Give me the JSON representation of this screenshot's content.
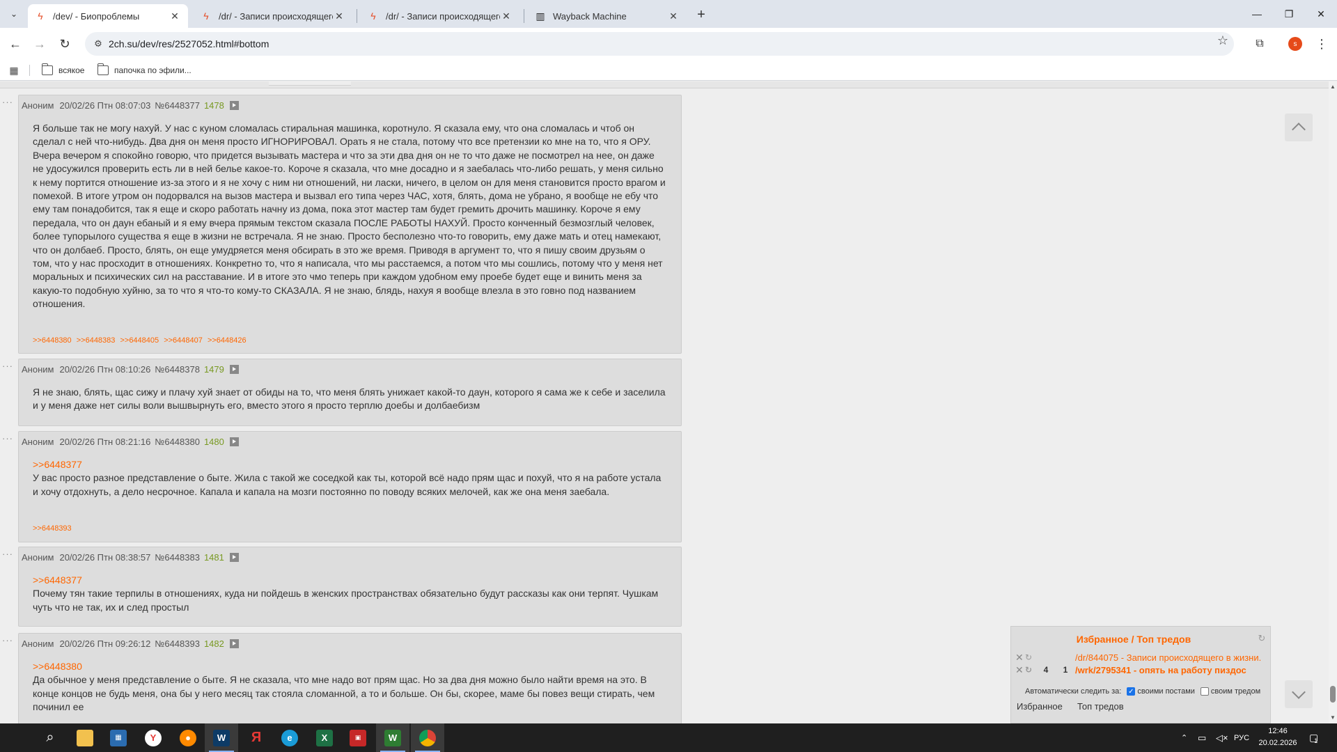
{
  "browser": {
    "tabs": [
      {
        "title": "/dev/ - Биопроблемы",
        "active": true
      },
      {
        "title": "/dr/ - Записи происходящего в жизни",
        "active": false
      },
      {
        "title": "/dr/ - Записи происходящего в жизни",
        "active": false
      },
      {
        "title": "Wayback Machine",
        "active": false
      }
    ],
    "url": "2ch.su/dev/res/2527052.html#bottom",
    "profile_initial": "s",
    "bookmarks": [
      "всякое",
      "папочка по эфили..."
    ]
  },
  "posts": [
    {
      "name": "Аноним",
      "date": "20/02/26 Птн 08:07:03",
      "num": "№6448377",
      "count": "1478",
      "link": "",
      "text": "Я больше так не могу нахуй. У нас с куном сломалась стиральная машинка, коротнуло. Я сказала ему, что она сломалась и чтоб он сделал с ней что-нибудь. Два дня он меня просто ИГНОРИРОВАЛ. Орать я не стала, потому что все претензии ко мне на то, что я ОРУ. Вчера вечером я спокойно говорю, что придется вызывать мастера и что за эти два дня он не то что даже не посмотрел на нее, он даже не удосужился проверить есть ли в ней белье какое-то. Короче я сказала, что мне досадно и я заебалась что-либо решать, у меня сильно к нему портится отношение из-за этого и я не хочу с ним ни отношений, ни ласки, ничего, в целом он для меня становится просто врагом и помехой. В итоге утром он подорвался на вызов мастера и вызвал его типа через ЧАС, хотя, блять, дома не убрано, я вообще не ебу что ему там понадобится, так я еще и скоро работать начну из дома, пока этот мастер там будет гремить дрочить машинку. Короче я ему передала, что он даун ебаный и я ему вчера прямым текстом сказала ПОСЛЕ РАБОТЫ НАХУЙ. Просто конченный безмозглый человек, более тупорылого существа я еще в жизни не встречала. Я не знаю. Просто бесполезно что-то говорить, ему даже мать и отец намекают, что он долбаеб. Просто, блять, он еще умудряется меня обсирать в это же время. Приводя в аргумент то, что я пишу своим друзьям о том, что у нас просходит в отношениях. Конкретно то, что я написала, что мы расстаемся, а потом что мы сошлись, потому что у меня нет моральных и психических сил на расставание. И в итоге это чмо теперь при каждом удобном ему проебе будет еще и винить меня за какую-то подобную хуйню, за то что я что-то кому-то СКАЗАЛА. Я не знаю, блядь, нахуя я вообще влезла в это говно под названием отношения.",
      "replies": [
        ">>6448380",
        ">>6448383",
        ">>6448405",
        ">>6448407",
        ">>6448426"
      ]
    },
    {
      "name": "Аноним",
      "date": "20/02/26 Птн 08:10:26",
      "num": "№6448378",
      "count": "1479",
      "link": "",
      "text": "Я не знаю, блять, щас сижу и плачу хуй знает от обиды на то, что меня блять унижает какой-то даун, которого я сама же к себе и заселила и у меня даже нет силы воли вышвырнуть его, вместо этого я просто терплю доебы и долбаебизм",
      "replies": []
    },
    {
      "name": "Аноним",
      "date": "20/02/26 Птн 08:21:16",
      "num": "№6448380",
      "count": "1480",
      "link": ">>6448377",
      "text": "У вас просто разное представление о быте. Жила с такой же соседкой как ты, которой всё надо прям щас и похуй, что я на работе устала и хочу отдохнуть, а дело несрочное. Капала и капала на мозги постоянно по поводу всяких мелочей, как же она меня заебала.",
      "replies": [
        ">>6448393"
      ]
    },
    {
      "name": "Аноним",
      "date": "20/02/26 Птн 08:38:57",
      "num": "№6448383",
      "count": "1481",
      "link": ">>6448377",
      "text": "Почему тян такие терпилы в отношениях, куда ни пойдешь в женских пространствах обязательно будут рассказы как они терпят. Чушкам чуть что не так, их и след простыл",
      "replies": []
    },
    {
      "name": "Аноним",
      "date": "20/02/26 Птн 09:26:12",
      "num": "№6448393",
      "count": "1482",
      "link": ">>6448380",
      "text": "Да обычное у меня представление о быте. Я не сказала, что мне надо вот прям щас. Но за два дня можно было найти время на это. В конце концов не будь меня, она бы у него месяц так стояла сломанной, а то и больше. Он бы, скорее, маме бы повез вещи стирать, чем починил ее",
      "replies": []
    }
  ],
  "favorites": {
    "title": "Избранное / Топ тредов",
    "items": [
      {
        "n1": "",
        "n2": "",
        "title": "/dr/844075 - Записи происходящего в жизни."
      },
      {
        "n1": "4",
        "n2": "1",
        "title": "/wrk/2795341 - опять на работу пиздос"
      }
    ],
    "auto_label": "Автоматически следить за:",
    "own_posts": "своими постами",
    "own_thread": "своим тредом",
    "tab_favorites": "Избранное",
    "tab_top": "Топ тредов"
  },
  "taskbar": {
    "lang": "РУС",
    "time": "12:46",
    "date": "20.02.2026",
    "notif_count": "1"
  },
  "colors": {
    "accent": "#ff6600",
    "post_bg": "#dddddd",
    "count_green": "#789922"
  }
}
